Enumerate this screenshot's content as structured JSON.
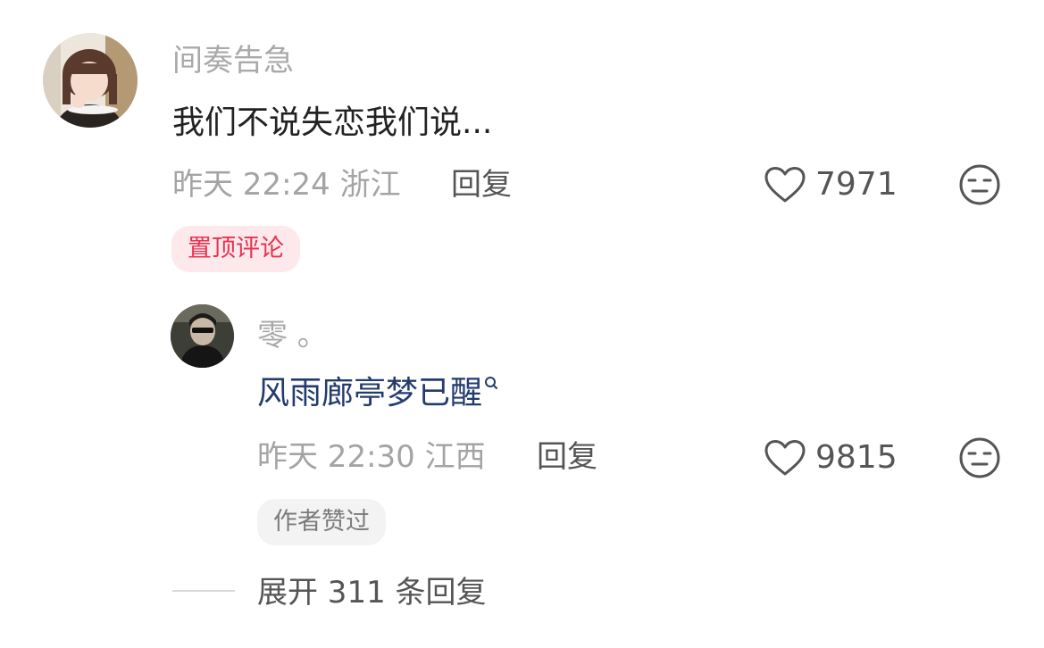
{
  "comment": {
    "username": "间奏告急",
    "text": "我们不说失恋我们说...",
    "time": "昨天 22:24",
    "location": "浙江",
    "reply_label": "回复",
    "like_count": "7971",
    "badge": "置顶评论"
  },
  "reply": {
    "username": "零 。",
    "text": "风雨廊亭梦已醒",
    "time": "昨天 22:30",
    "location": "江西",
    "reply_label": "回复",
    "like_count": "9815",
    "badge": "作者赞过"
  },
  "expand": {
    "label": "展开 311 条回复"
  },
  "icons": {
    "like": "heart-outline-icon",
    "dislike": "neutral-face-icon",
    "search": "search-icon"
  },
  "colors": {
    "pinned_badge_bg": "#fde9ec",
    "pinned_badge_text": "#e8324f",
    "link_text": "#233b6e"
  }
}
